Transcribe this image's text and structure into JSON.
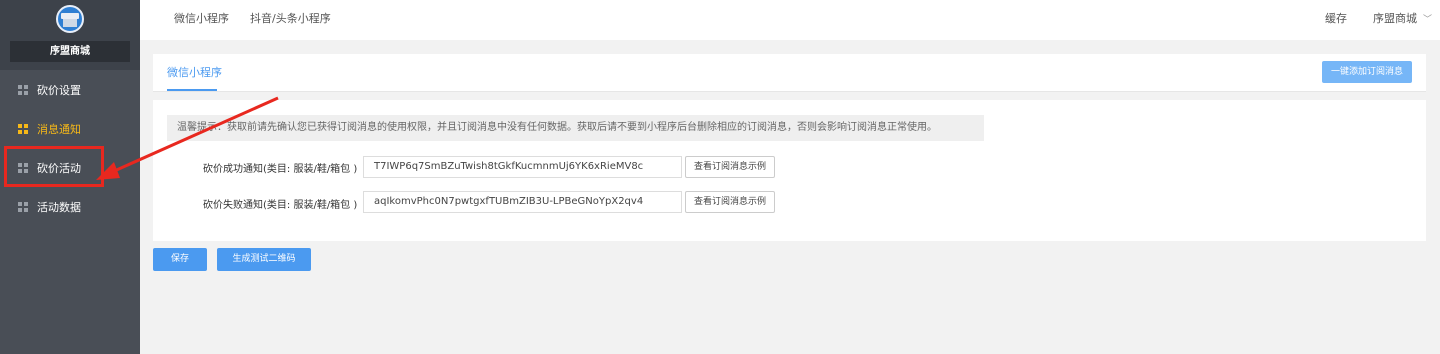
{
  "sidebar": {
    "shop_name": "序盟商城",
    "items": [
      {
        "label": "砍价设置",
        "icon": "grid-icon",
        "active": false
      },
      {
        "label": "消息通知",
        "icon": "grid-icon",
        "active": true
      },
      {
        "label": "砍价活动",
        "icon": "grid-icon",
        "active": false
      },
      {
        "label": "活动数据",
        "icon": "grid-icon",
        "active": false
      }
    ]
  },
  "topbar": {
    "tabs": [
      "微信小程序",
      "抖音/头条小程序"
    ],
    "cache": "缓存",
    "shop_menu": "序盟商城"
  },
  "panel": {
    "tab": "微信小程序",
    "add_button": "一键添加订阅消息"
  },
  "content": {
    "notice": "温馨提示：获取前请先确认您已获得订阅消息的使用权限，并且订阅消息中没有任何数据。获取后请不要到小程序后台删除相应的订阅消息，否则会影响订阅消息正常使用。",
    "fields": [
      {
        "label": "砍价成功通知(类目: 服装/鞋/箱包 )",
        "value": "T7IWP6q7SmBZuTwish8tGkfKucmnmUj6YK6xRieMV8c",
        "button": "查看订阅消息示例"
      },
      {
        "label": "砍价失败通知(类目: 服装/鞋/箱包 )",
        "value": "aqIkomvPhc0N7pwtgxfTUBmZIB3U-LPBeGNoYpX2qv4",
        "button": "查看订阅消息示例"
      }
    ]
  },
  "actions": {
    "save": "保存",
    "qr": "生成测试二维码"
  },
  "colors": {
    "sidebar_bg": "#494e56",
    "active": "#f6b818",
    "primary": "#4b9af0",
    "annotation": "#e8281f"
  }
}
